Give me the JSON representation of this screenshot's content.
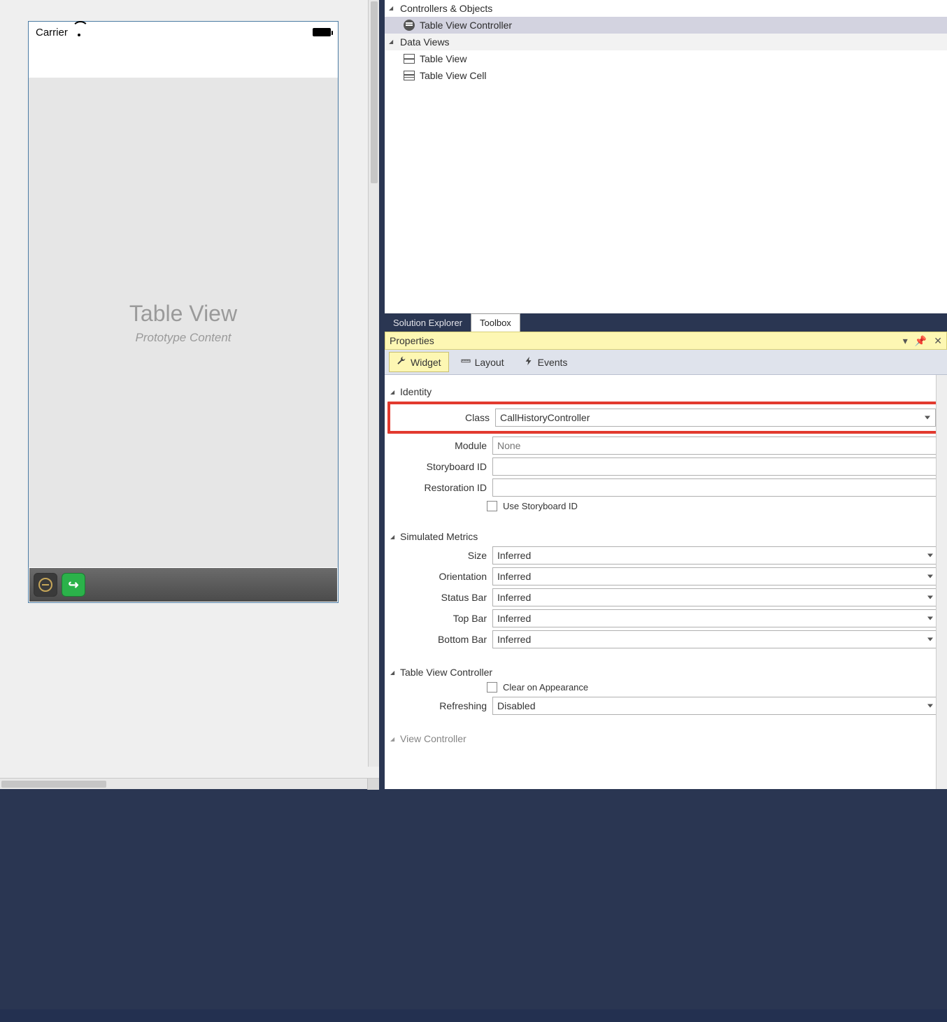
{
  "designer": {
    "carrier": "Carrier",
    "tableview_title": "Table View",
    "tableview_sub": "Prototype Content"
  },
  "outline": {
    "group1": "Controllers & Objects",
    "item1": "Table View Controller",
    "group2": "Data Views",
    "item2": "Table View",
    "item3": "Table View Cell"
  },
  "panel_tabs": {
    "solution_explorer": "Solution Explorer",
    "toolbox": "Toolbox"
  },
  "props": {
    "title": "Properties",
    "tabs": {
      "widget": "Widget",
      "layout": "Layout",
      "events": "Events"
    },
    "identity": {
      "header": "Identity",
      "class_label": "Class",
      "class_value": "CallHistoryController",
      "module_label": "Module",
      "module_placeholder": "None",
      "storyboard_label": "Storyboard ID",
      "storyboard_value": "",
      "restoration_label": "Restoration ID",
      "restoration_value": "",
      "use_storyboard": "Use Storyboard ID"
    },
    "metrics": {
      "header": "Simulated Metrics",
      "size_label": "Size",
      "size_value": "Inferred",
      "orientation_label": "Orientation",
      "orientation_value": "Inferred",
      "statusbar_label": "Status Bar",
      "statusbar_value": "Inferred",
      "topbar_label": "Top Bar",
      "topbar_value": "Inferred",
      "bottombar_label": "Bottom Bar",
      "bottombar_value": "Inferred"
    },
    "tvc": {
      "header": "Table View Controller",
      "clear_label": "Clear on Appearance",
      "refreshing_label": "Refreshing",
      "refreshing_value": "Disabled"
    },
    "vc": {
      "header": "View Controller"
    }
  }
}
